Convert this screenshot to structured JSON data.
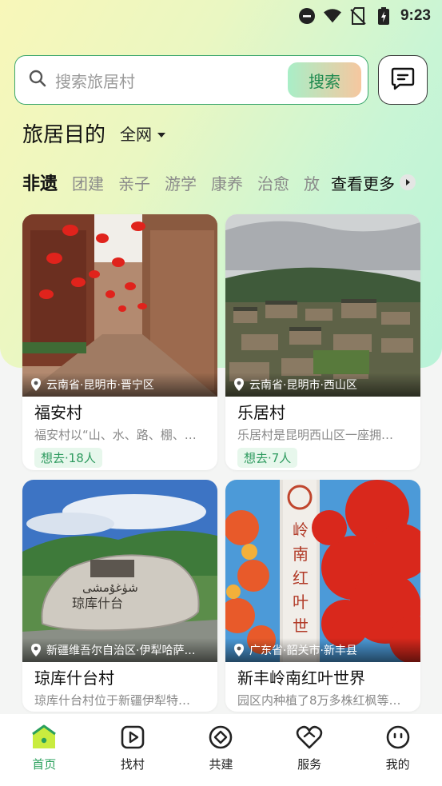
{
  "status_bar": {
    "time": "9:23"
  },
  "search": {
    "placeholder": "搜索旅居村",
    "button_label": "搜索"
  },
  "destination": {
    "title": "旅居目的",
    "scope": "全网"
  },
  "tabs": {
    "items": [
      "非遗",
      "团建",
      "亲子",
      "游学",
      "康养",
      "治愈",
      "放"
    ],
    "active": "非遗",
    "more_label": "查看更多"
  },
  "cards": [
    {
      "location": "云南省·昆明市·晋宁区",
      "name": "福安村",
      "desc": "福安村以“山、水、路、棚、…",
      "want": "想去·18人"
    },
    {
      "location": "云南省·昆明市·西山区",
      "name": "乐居村",
      "desc": "乐居村是昆明西山区一座拥…",
      "want": "想去·7人"
    },
    {
      "location": "新疆维吾尔自治区·伊犁哈萨…",
      "name": "琼库什台村",
      "desc": "琼库什台村位于新疆伊犁特…",
      "want": ""
    },
    {
      "location": "广东省·韶关市·新丰县",
      "name": "新丰岭南红叶世界",
      "desc": "园区内种植了8万多株红枫等…",
      "want": ""
    }
  ],
  "bottom_nav": [
    {
      "label": "首页",
      "icon": "home-icon",
      "active": true
    },
    {
      "label": "找村",
      "icon": "play-icon",
      "active": false
    },
    {
      "label": "共建",
      "icon": "diamond-icon",
      "active": false
    },
    {
      "label": "服务",
      "icon": "heart-icon",
      "active": false
    },
    {
      "label": "我的",
      "icon": "face-icon",
      "active": false
    }
  ],
  "colors": {
    "accent": "#2aa05c",
    "border": "#3aa66c"
  }
}
